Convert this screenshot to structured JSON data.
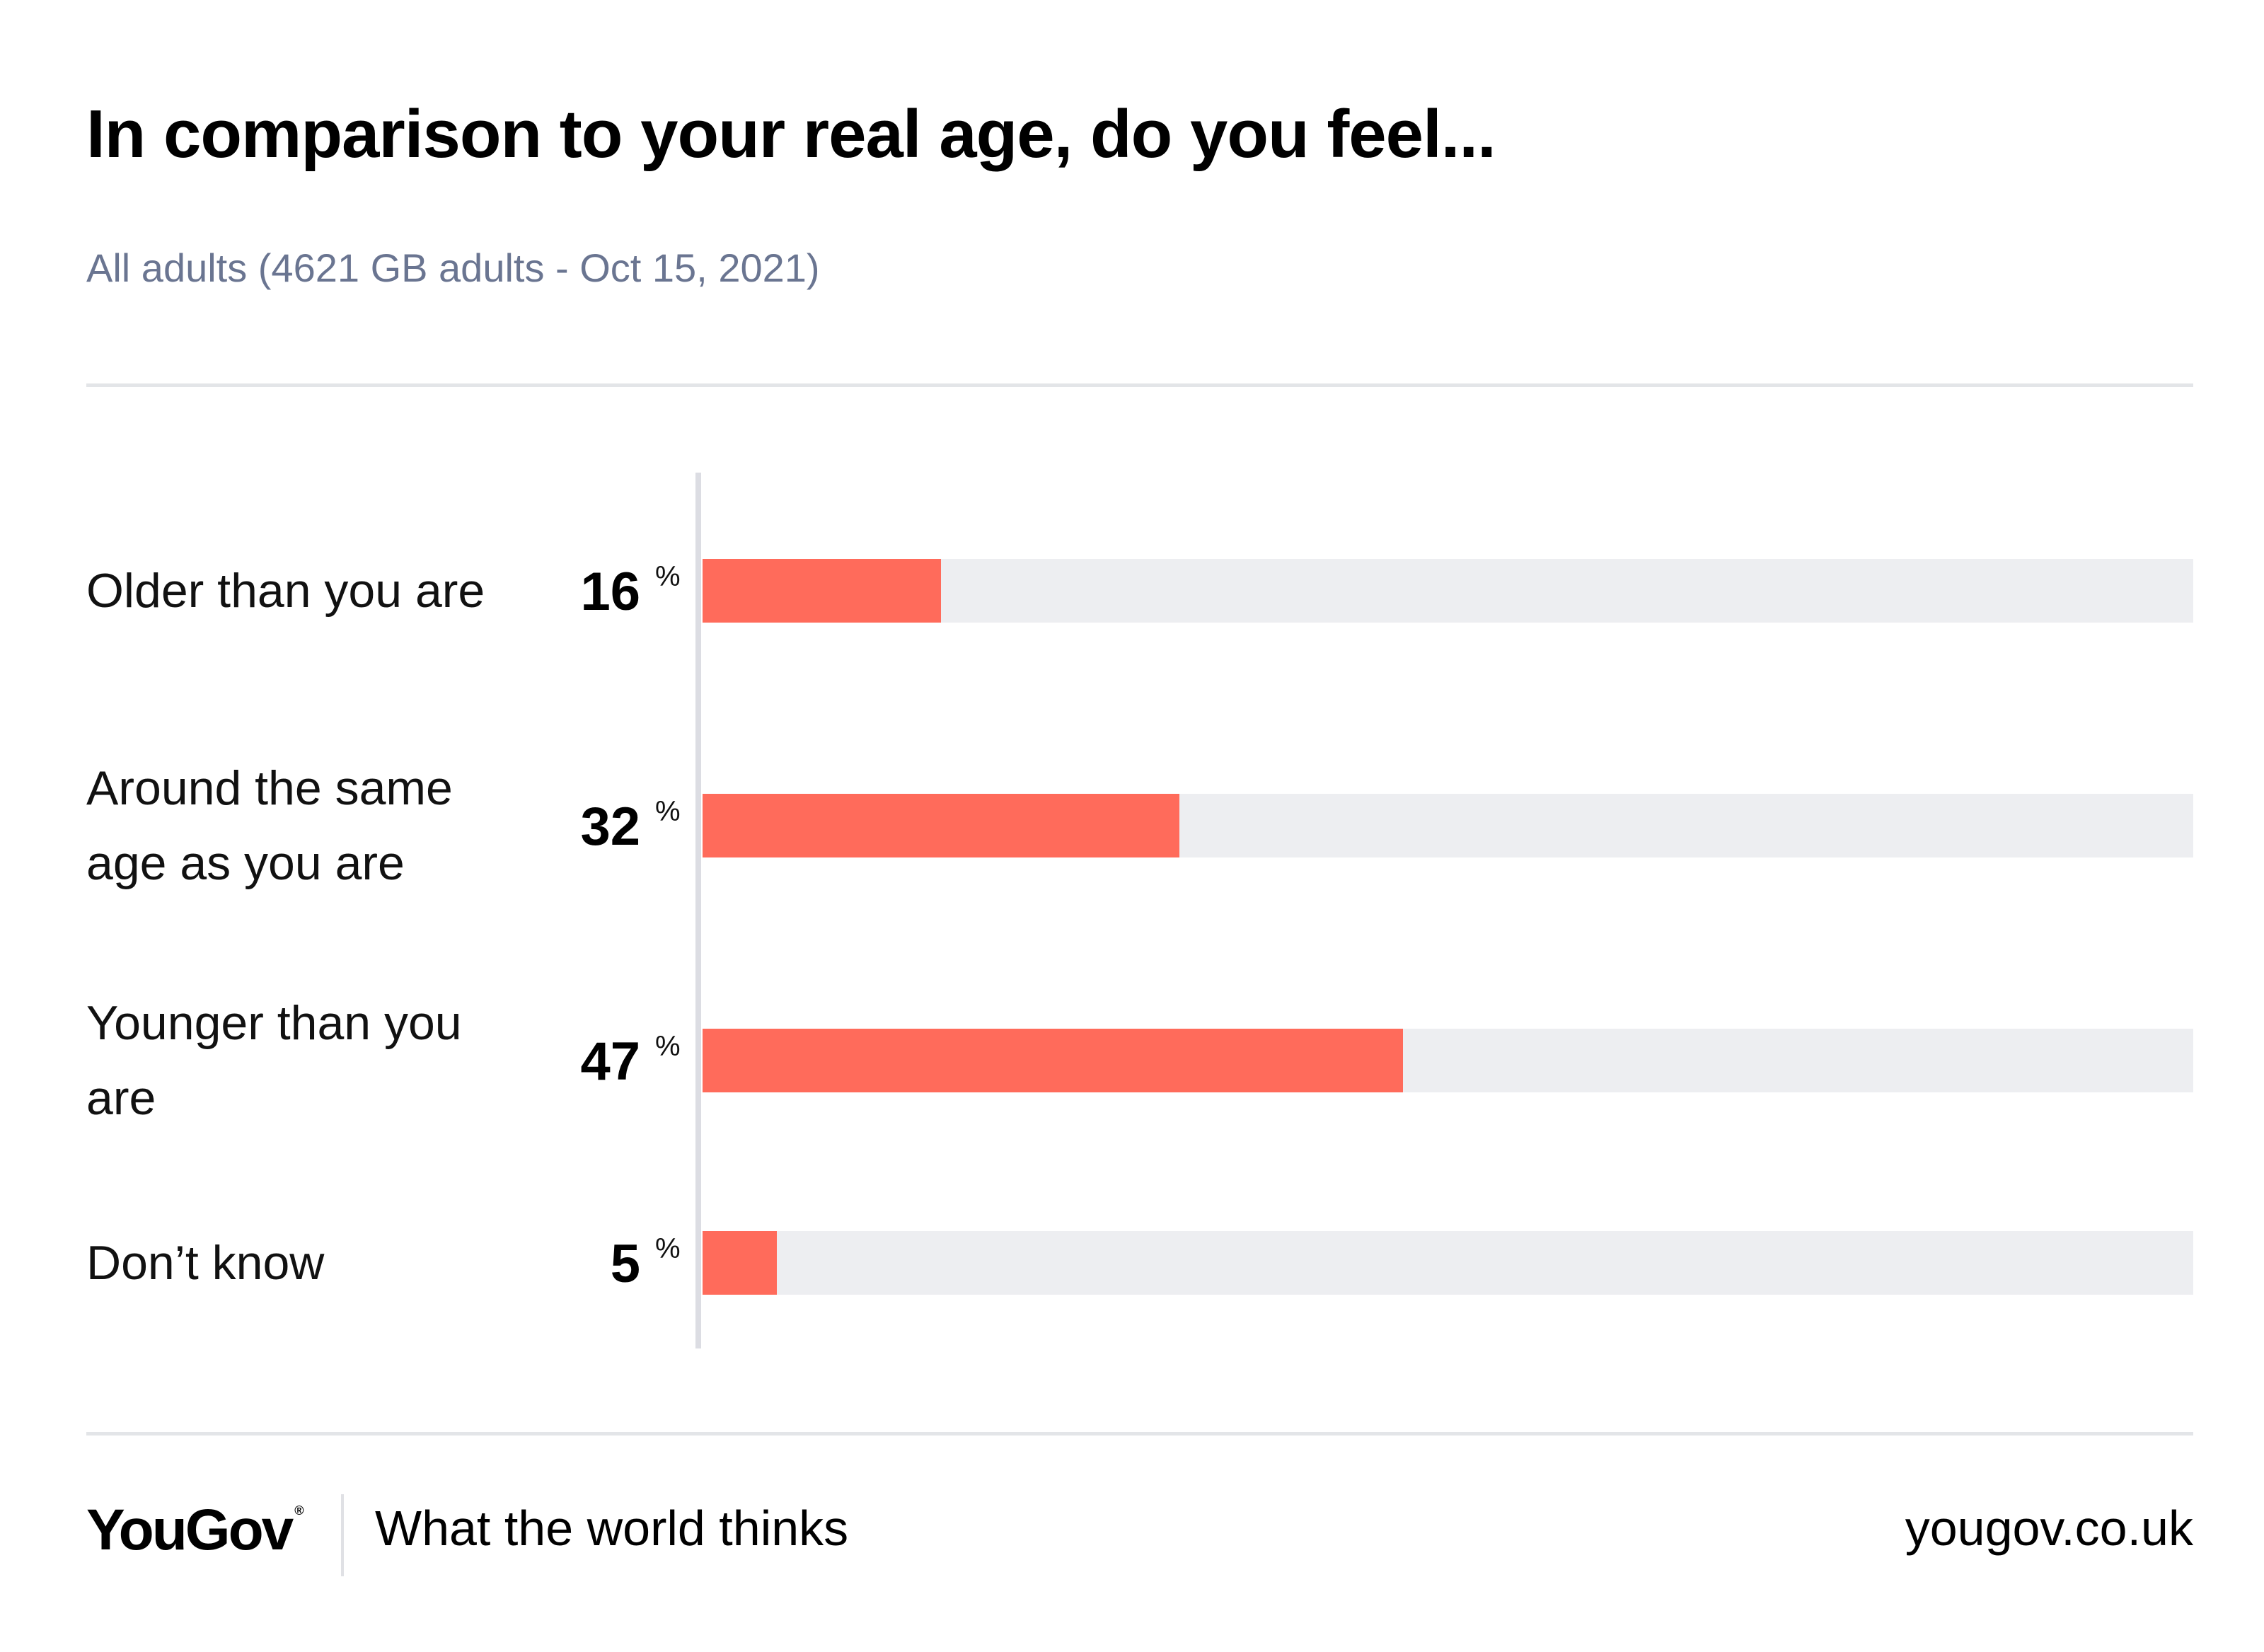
{
  "header": {
    "title": "In comparison to your real age, do you feel...",
    "subtitle": "All adults (4621 GB adults - Oct 15, 2021)"
  },
  "chart_data": {
    "type": "bar",
    "orientation": "horizontal",
    "categories": [
      "Older than you are",
      "Around the same age as you are",
      "Younger than you are",
      "Don’t know"
    ],
    "values": [
      16,
      32,
      47,
      5
    ],
    "value_labels": [
      "16",
      "32",
      "47",
      "5"
    ],
    "unit": "%",
    "xlim": [
      0,
      100
    ],
    "grid": false,
    "bar_color": "#ff6b5b",
    "track_color": "#edeef1"
  },
  "footer": {
    "brand": "YouGov",
    "registered_mark": "®",
    "tagline": "What the world thinks",
    "url": "yougov.co.uk"
  }
}
